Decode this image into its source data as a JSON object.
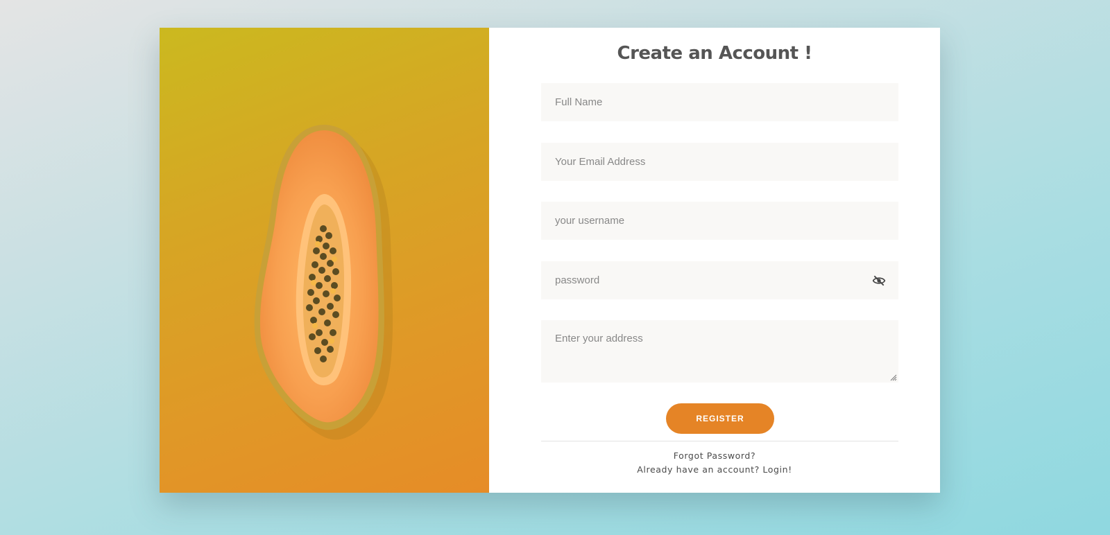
{
  "form": {
    "title": "Create an Account !",
    "full_name_placeholder": "Full Name",
    "email_placeholder": "Your Email Address",
    "username_placeholder": "your username",
    "password_placeholder": "password",
    "address_placeholder": "Enter your address",
    "register_label": "REGISTER",
    "forgot_password_label": "Forgot Password?",
    "login_link_label": "Already have an account? Login!"
  },
  "colors": {
    "accent": "#e58426",
    "title": "#555555",
    "field_background": "#f9f8f6",
    "image_gradient_start": "#cbb91f",
    "image_gradient_end": "#e68c27"
  },
  "icons": {
    "password_toggle": "eye-slash-icon"
  }
}
